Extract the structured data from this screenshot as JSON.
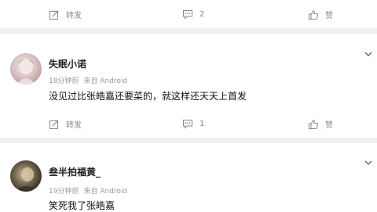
{
  "top_bar": {
    "repost_label": "转发",
    "comment_count": "2",
    "like_label": "赞"
  },
  "comments": [
    {
      "author": "失眠小诺",
      "time": "18分钟前",
      "source": "来自 Android",
      "text": "没见过比张皓嘉还要菜的，就这样还天天上首发",
      "repost_label": "转发",
      "comment_count": "1",
      "like_label": "赞"
    },
    {
      "author": "叁半拍福黄_",
      "time": "19分钟前",
      "source": "来自 Android",
      "text": "笑死我了张皓嘉"
    }
  ],
  "icons": {
    "repost": "repost-icon",
    "comment": "comment-icon",
    "like": "thumbs-up-icon",
    "more": "chevron-down-icon"
  }
}
